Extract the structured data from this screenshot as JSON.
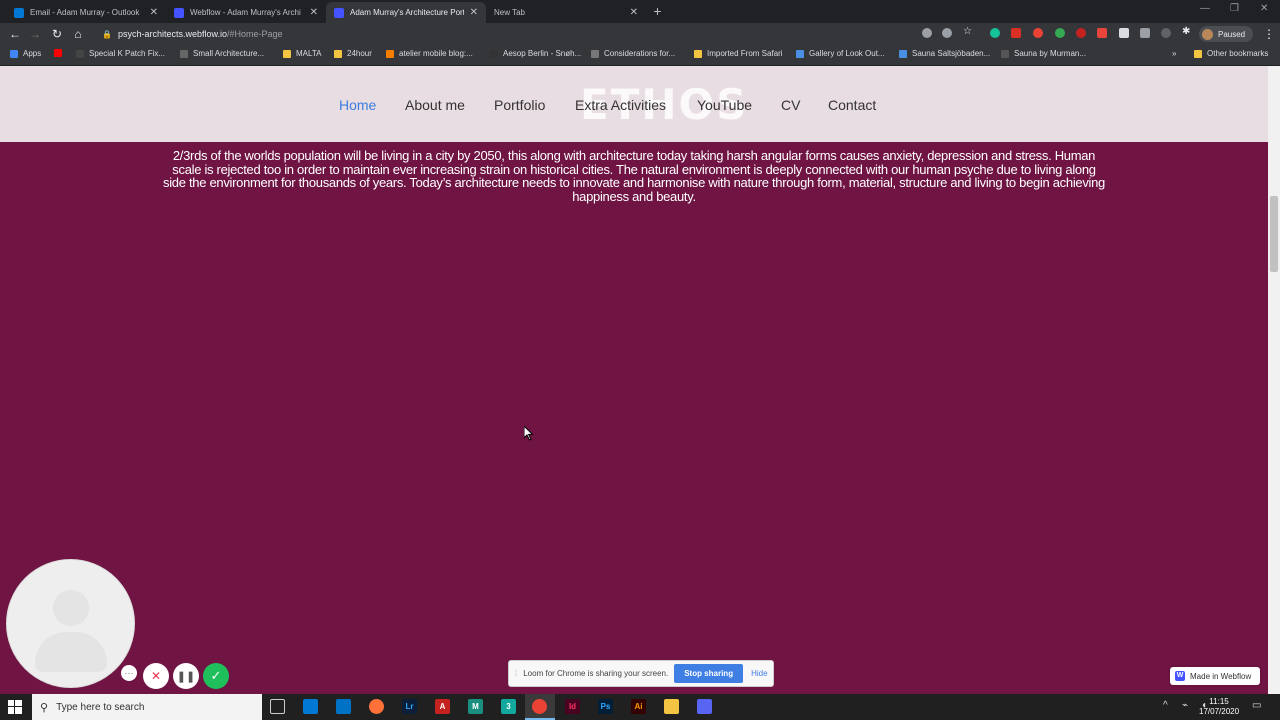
{
  "browser": {
    "tabs": [
      {
        "title": "Email - Adam Murray - Outlook",
        "color": "#0078d4",
        "active": false
      },
      {
        "title": "Webflow - Adam Murray's Archi",
        "color": "#4353ff",
        "active": false
      },
      {
        "title": "Adam Murray's Architecture Port",
        "color": "#4353ff",
        "active": true
      },
      {
        "title": "New Tab",
        "color": "",
        "active": false
      }
    ],
    "url_host": "psych-architects.webflow.io",
    "url_path": "/#Home-Page",
    "profile_label": "Paused",
    "bookmarks": [
      "Apps",
      "Special K Patch Fix...",
      "Small Architecture...",
      "MALTA",
      "24hour",
      "atelier mobile blog:...",
      "Aesop Berlin - Snøh...",
      "Considerations for...",
      "Imported From Safari",
      "Gallery of Look Out...",
      "Sauna Saltsjöbaden...",
      "Sauna by Murman...",
      "Other bookmarks"
    ]
  },
  "site": {
    "logo": "ETHOS",
    "nav": [
      "Home",
      "About me",
      "Portfolio",
      "Extra Activities",
      "YouTube",
      "CV",
      "Contact"
    ],
    "hero_text": "2/3rds of the worlds population will be living in a city by 2050, this along with architecture today taking harsh angular forms causes anxiety, depression and stress. Human scale is rejected too in order to maintain ever increasing strain on historical cities. The natural environment is deeply connected with our human psyche due to living along side the environment for thousands of years. Today’s architecture needs to innovate and harmonise with nature through form, material, structure and living to begin achieving happiness and beauty.",
    "background_color": "#6f1443",
    "badge": "Made in Webflow"
  },
  "loom": {
    "share_message": "Loom for Chrome is sharing your screen.",
    "stop_label": "Stop sharing",
    "hide_label": "Hide"
  },
  "taskbar": {
    "search_placeholder": "Type here to search",
    "time": "11:15",
    "date": "17/07/2020"
  }
}
